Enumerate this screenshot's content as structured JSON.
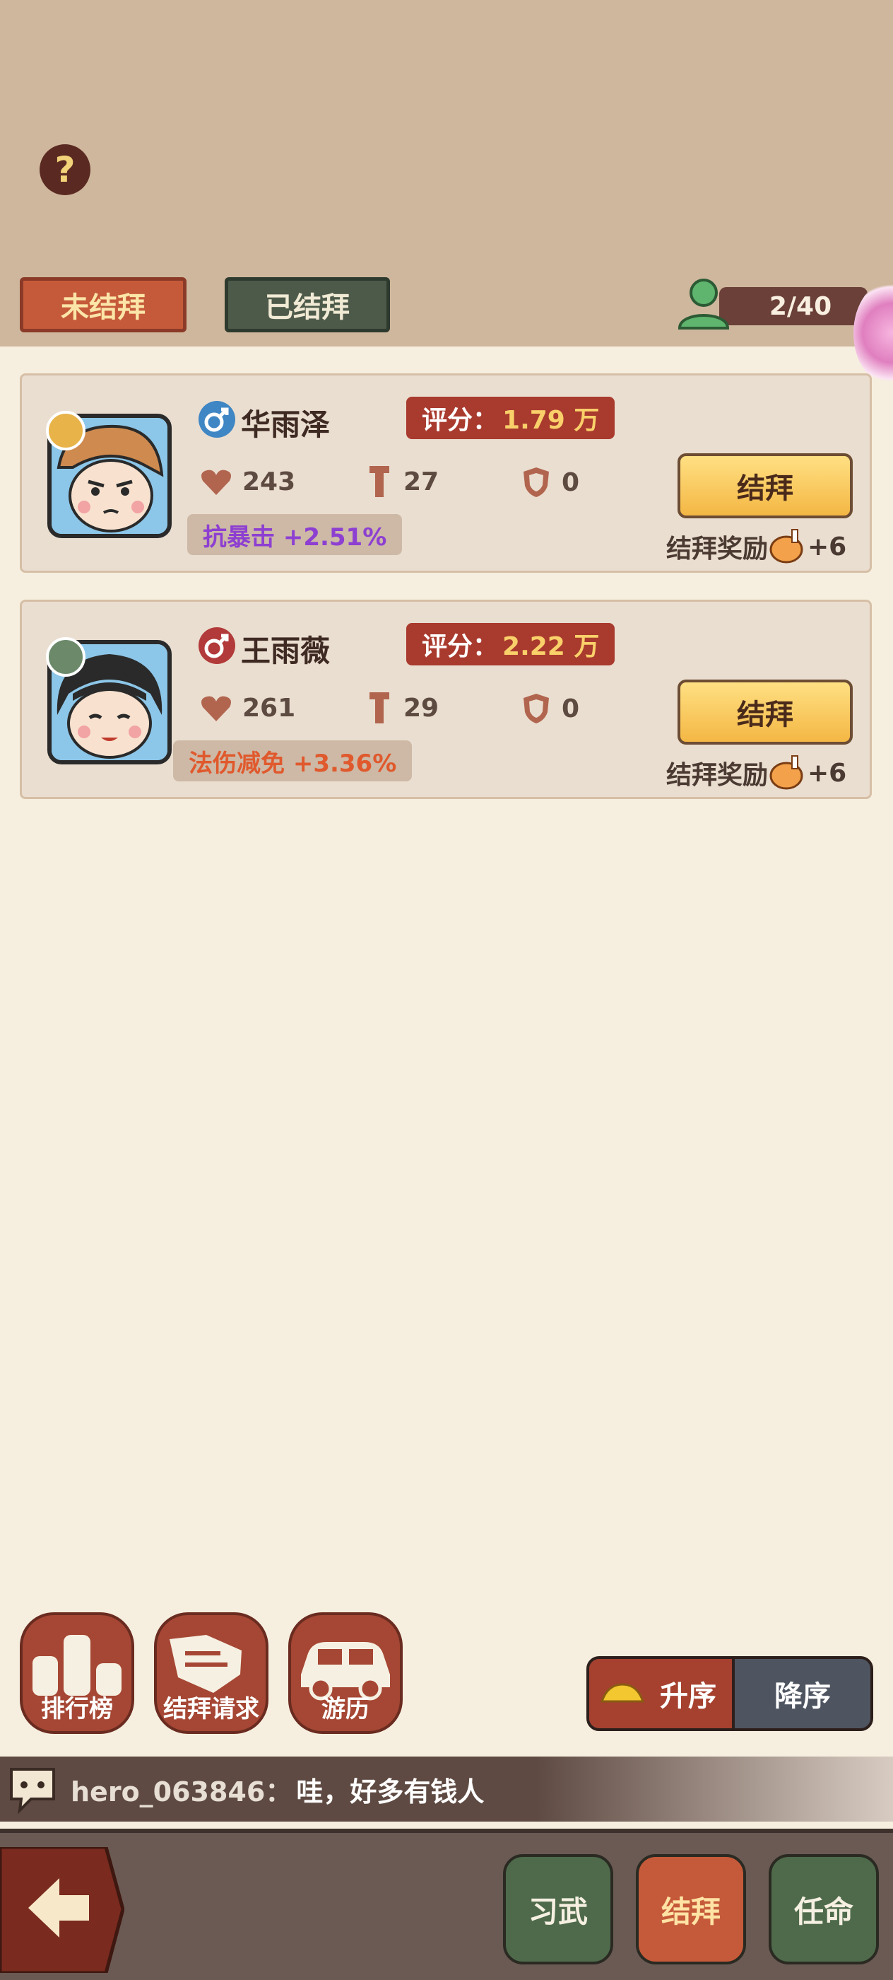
{
  "help": {
    "label": "?"
  },
  "tabs": [
    {
      "label": "未结拜",
      "active": true
    },
    {
      "label": "已结拜",
      "active": false
    }
  ],
  "member_count": "2/40",
  "cards": [
    {
      "name": "华雨泽",
      "gender": "male",
      "score_label": "评分：",
      "score_value": "1.79 万",
      "hp": "243",
      "attack": "27",
      "defense": "0",
      "trait": "抗暴击 +2.51%",
      "trait_color": "#8d3fd1",
      "button_label": "结拜",
      "reward_label": "结拜奖励",
      "reward_value": "+6"
    },
    {
      "name": "王雨薇",
      "gender": "female",
      "score_label": "评分：",
      "score_value": "2.22 万",
      "hp": "261",
      "attack": "29",
      "defense": "0",
      "trait": "法伤减免 +3.36%",
      "trait_color": "#e0592d",
      "button_label": "结拜",
      "reward_label": "结拜奖励",
      "reward_value": "+6"
    }
  ],
  "actions": [
    {
      "label": "排行榜",
      "icon": "podium-icon"
    },
    {
      "label": "结拜请求",
      "icon": "handshake-icon"
    },
    {
      "label": "游历",
      "icon": "car-icon"
    }
  ],
  "sort": {
    "asc_label": "升序",
    "desc_label": "降序",
    "selected": "asc"
  },
  "chat": {
    "user": "hero_063846：",
    "message": "哇，好多有钱人"
  },
  "nav": [
    {
      "label": "习武",
      "active": false
    },
    {
      "label": "结拜",
      "active": true
    },
    {
      "label": "任命",
      "active": false
    }
  ]
}
